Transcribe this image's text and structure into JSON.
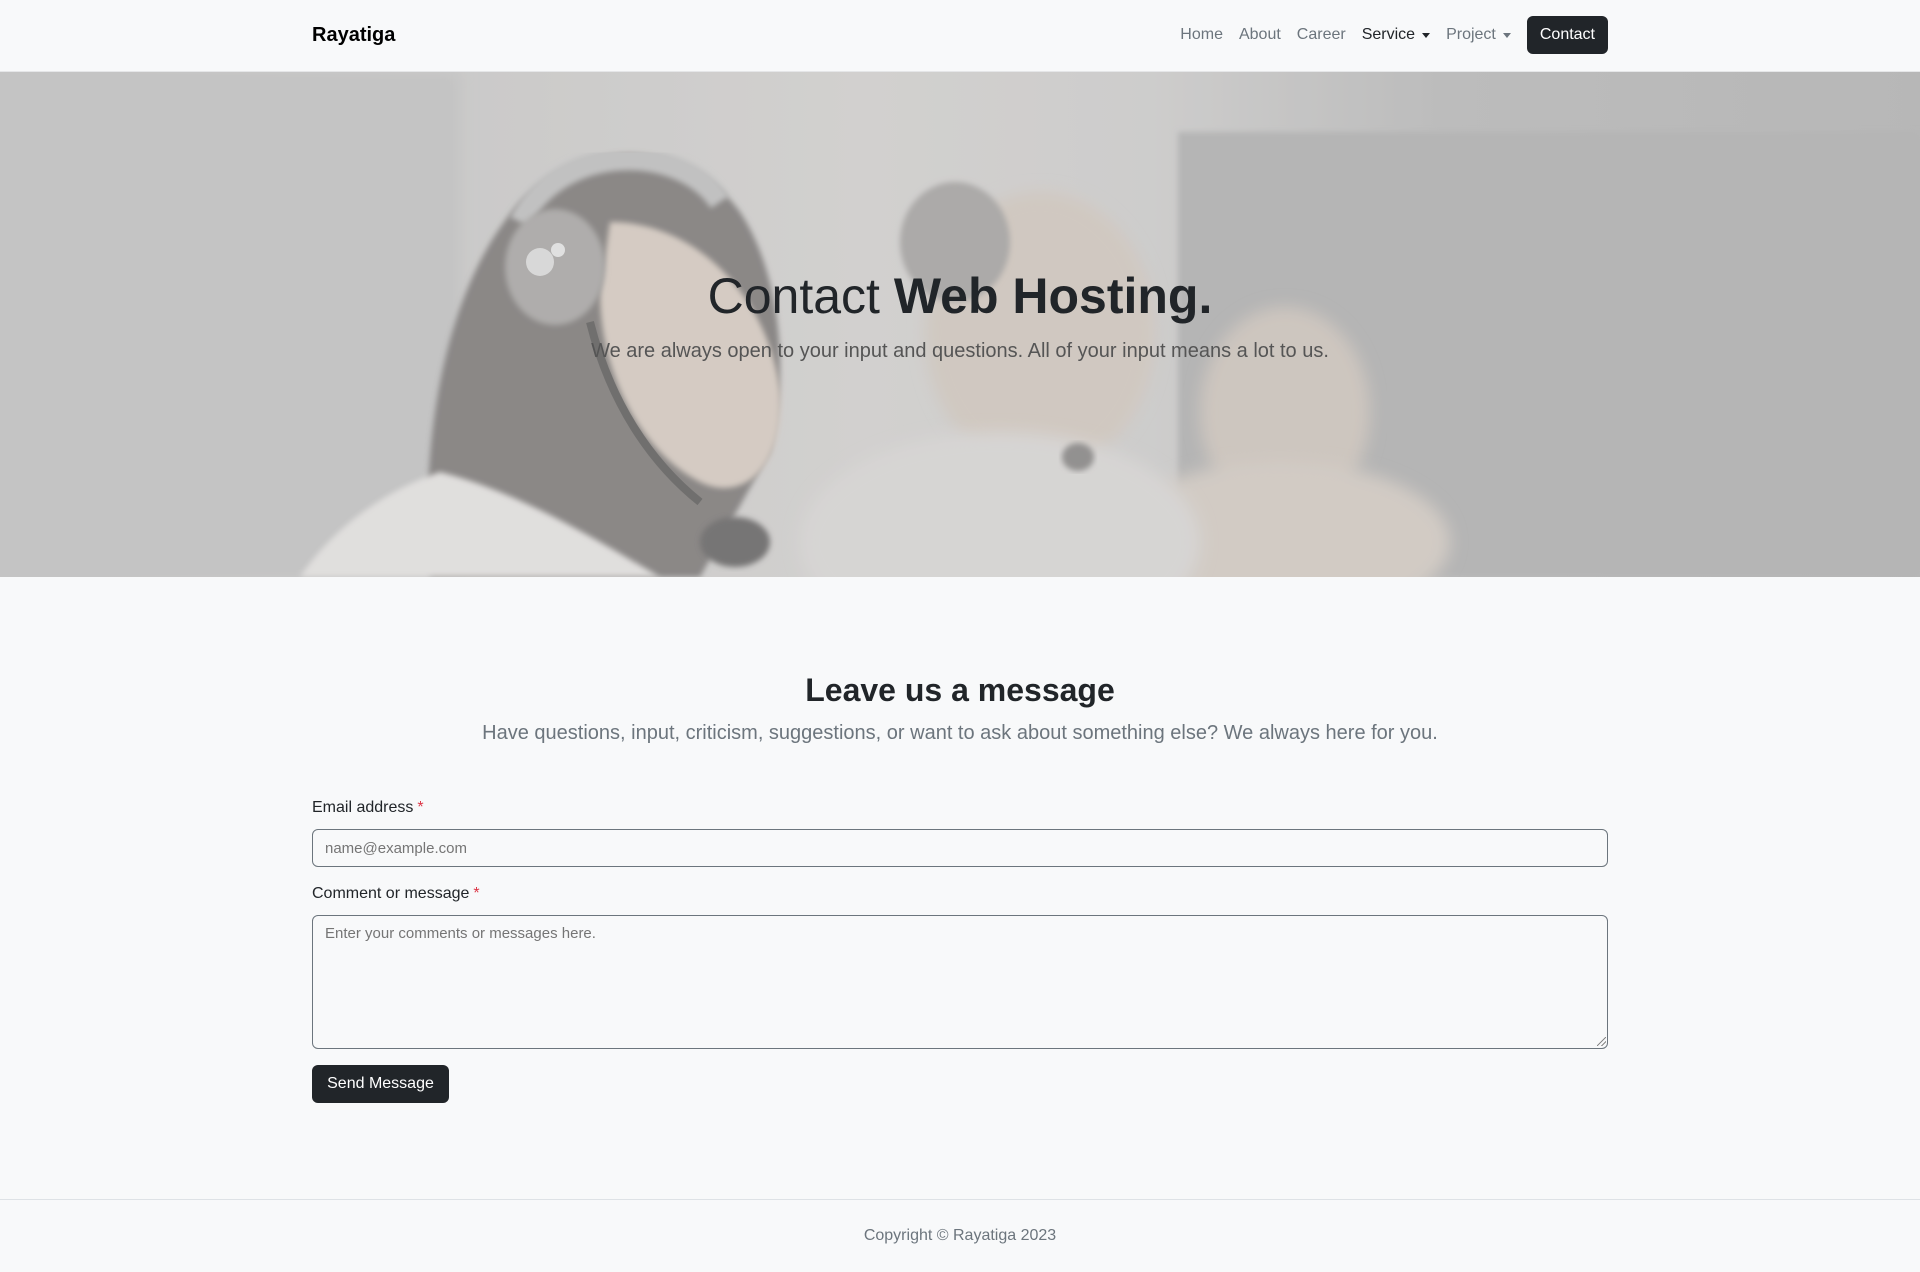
{
  "navbar": {
    "brand": "Rayatiga",
    "links": [
      "Home",
      "About",
      "Career",
      "Service",
      "Project"
    ],
    "contact_label": "Contact"
  },
  "hero": {
    "title_light": "Contact ",
    "title_bold": "Web Hosting.",
    "subtitle": "We are always open to your input and questions. All of your input means a lot to us."
  },
  "message": {
    "title": "Leave us a message",
    "subtitle": "Have questions, input, criticism, suggestions, or want to ask about something else? We always here for you.",
    "email_label": "Email address",
    "email_placeholder": "name@example.com",
    "comment_label": "Comment or message",
    "comment_placeholder": "Enter your comments or messages here.",
    "required_mark": "*",
    "send_label": "Send Message"
  },
  "footer": {
    "copyright": "Copyright © Rayatiga 2023"
  }
}
